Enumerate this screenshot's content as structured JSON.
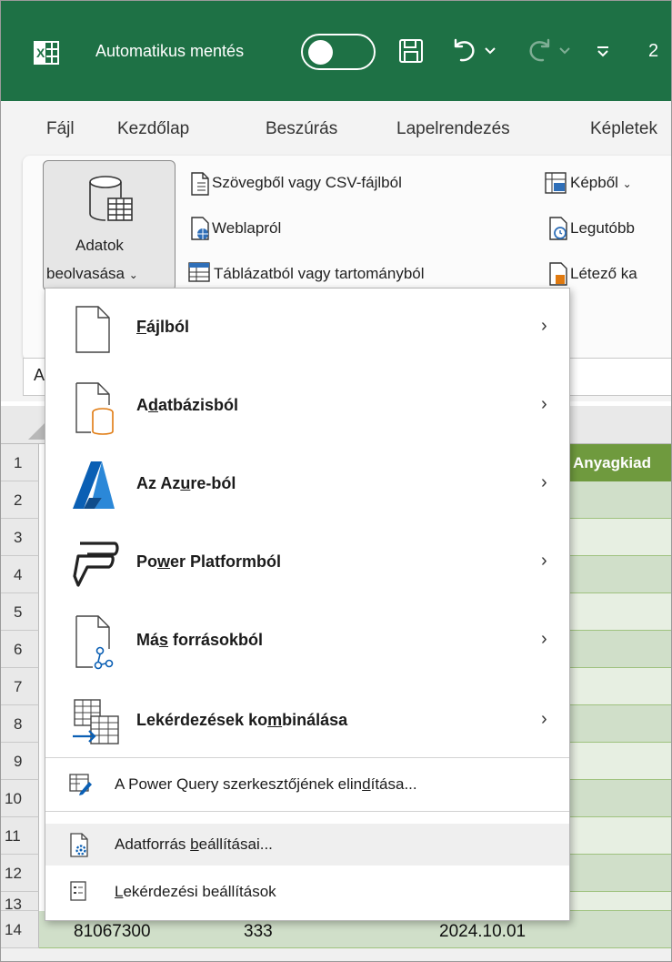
{
  "titlebar": {
    "autosave_label": "Automatikus mentés",
    "partial_text": "2"
  },
  "menu": {
    "items": [
      "Fájl",
      "Kezdőlap",
      "Beszúrás",
      "Lapelrendezés",
      "Képletek"
    ]
  },
  "ribbon": {
    "get_data_line1": "Adatok",
    "get_data_line2": "beolvasása",
    "from_text_csv": "Szövegből vagy CSV-fájlból",
    "from_web": "Weblapról",
    "from_table": "Táblázatból vagy tartományból",
    "from_picture": "Képből",
    "recent": "Legutóbb",
    "existing": "Létező ka"
  },
  "formula_bar": {
    "namebox_partial": "A"
  },
  "grid": {
    "row_numbers": [
      "1",
      "2",
      "3",
      "4",
      "5",
      "6",
      "7",
      "8",
      "9",
      "10",
      "11",
      "12",
      "13",
      "14"
    ],
    "header_cell": "Anyagkiad",
    "row14": {
      "col_a": "81067300",
      "col_b": "333",
      "col_c": "2024.10.01"
    }
  },
  "dropdown": {
    "items": [
      {
        "pre": "",
        "u": "F",
        "post": "ájlból"
      },
      {
        "pre": "A",
        "u": "d",
        "post": "atbázisból"
      },
      {
        "pre": "Az Az",
        "u": "u",
        "post": "re-ból"
      },
      {
        "pre": "Po",
        "u": "w",
        "post": "er Platformból"
      },
      {
        "pre": "Má",
        "u": "s",
        "post": " forrásokból"
      },
      {
        "pre": "Lekérdezések ko",
        "u": "m",
        "post": "binálása"
      }
    ],
    "power_query": {
      "pre": "A Power Query szerkesztőjének elin",
      "u": "d",
      "post": "ítása..."
    },
    "data_source": {
      "pre": "Adatforrás ",
      "u": "b",
      "post": "eállításai..."
    },
    "query_options": {
      "pre": "",
      "u": "L",
      "post": "ekérdezési beállítások"
    }
  },
  "colors": {
    "excel_green": "#1e7145",
    "table_header": "#6f9a3e",
    "table_band": "#d0dfc9",
    "azure_blue": "#0a5fb4",
    "db_orange": "#e07a10"
  }
}
